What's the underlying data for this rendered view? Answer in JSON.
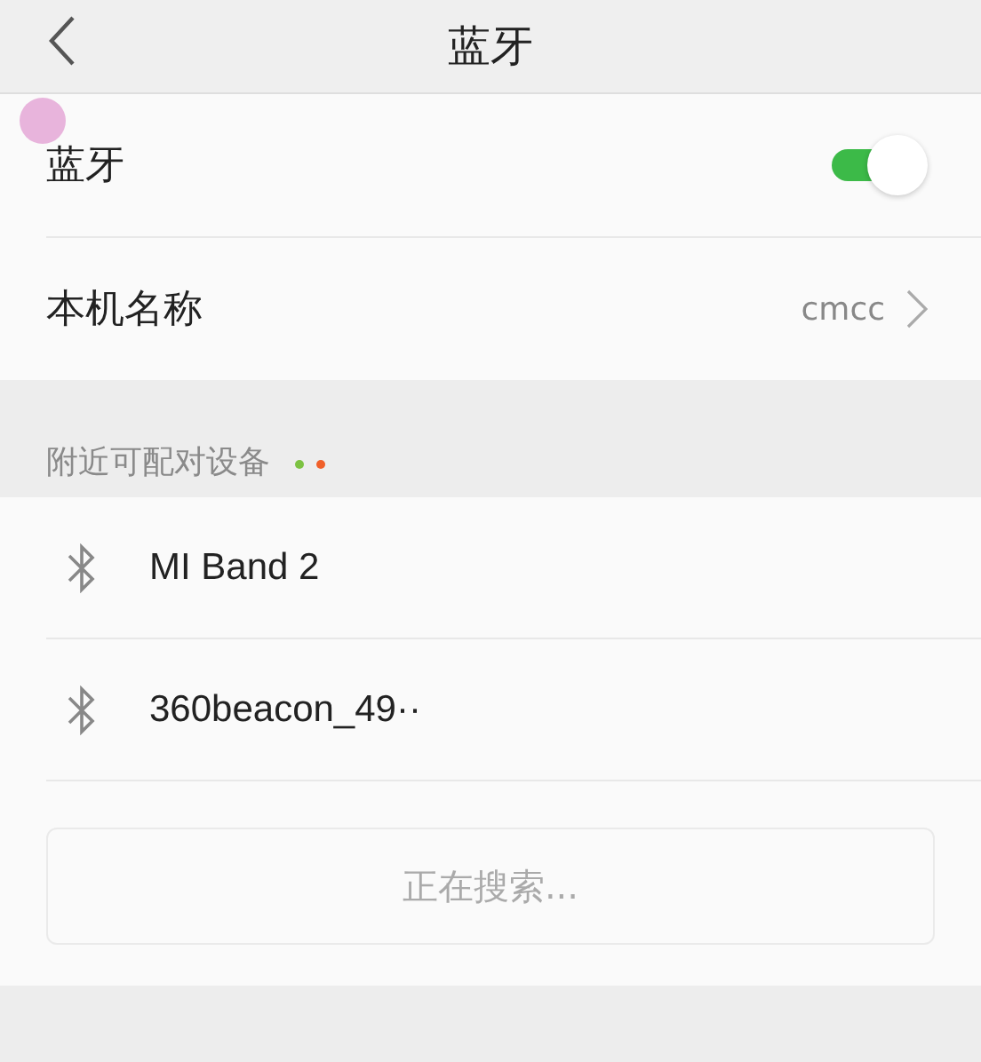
{
  "header": {
    "title": "蓝牙"
  },
  "settings": [
    {
      "kind": "toggle",
      "label": "蓝牙",
      "on": true
    },
    {
      "kind": "link",
      "label": "本机名称",
      "value": "cmcc"
    }
  ],
  "section": {
    "title": "附近可配对设备",
    "loading_dots": [
      {
        "color": "#7cc242"
      },
      {
        "color": "#f0602a"
      }
    ]
  },
  "devices": [
    {
      "name": "MI Band 2"
    },
    {
      "name": "360beacon_49··"
    }
  ],
  "status_button": {
    "label": "正在搜索..."
  }
}
